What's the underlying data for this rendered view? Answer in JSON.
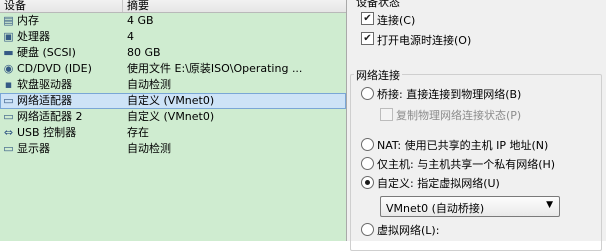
{
  "columns": {
    "device": "设备",
    "summary": "摘要"
  },
  "devices": [
    {
      "name": "内存",
      "summary": "4 GB",
      "icon": "memory-icon",
      "glyph": "▤"
    },
    {
      "name": "处理器",
      "summary": "4",
      "icon": "processor-icon",
      "glyph": "▣"
    },
    {
      "name": "硬盘 (SCSI)",
      "summary": "80 GB",
      "icon": "hard-disk-icon",
      "glyph": "▬"
    },
    {
      "name": "CD/DVD (IDE)",
      "summary": "使用文件 E:\\原装ISO\\Operating ...",
      "icon": "cd-dvd-icon",
      "glyph": "◉"
    },
    {
      "name": "软盘驱动器",
      "summary": "自动检测",
      "icon": "floppy-icon",
      "glyph": "▪"
    },
    {
      "name": "网络适配器",
      "summary": "自定义 (VMnet0)",
      "icon": "network-adapter-icon",
      "glyph": "▭"
    },
    {
      "name": "网络适配器 2",
      "summary": "自定义 (VMnet0)",
      "icon": "network-adapter-icon",
      "glyph": "▭"
    },
    {
      "name": "USB 控制器",
      "summary": "存在",
      "icon": "usb-icon",
      "glyph": "⇔"
    },
    {
      "name": "显示器",
      "summary": "自动检测",
      "icon": "display-icon",
      "glyph": "▭"
    }
  ],
  "selected_index": 5,
  "device_status": {
    "title": "设备状态",
    "connected": {
      "label": "连接(C)",
      "checked": true
    },
    "connect_at_power_on": {
      "label": "打开电源时连接(O)",
      "checked": true
    }
  },
  "network_connection": {
    "title": "网络连接",
    "bridged": {
      "label": "桥接: 直接连接到物理网络(B)",
      "selected": false
    },
    "replicate": {
      "label": "复制物理网络连接状态(P)",
      "checked": false,
      "disabled": true
    },
    "nat": {
      "label": "NAT: 使用已共享的主机 IP 地址(N)",
      "selected": false
    },
    "host_only": {
      "label": "仅主机: 与主机共享一个私有网络(H)",
      "selected": false
    },
    "custom": {
      "label": "自定义: 指定虚拟网络(U)",
      "selected": true
    },
    "custom_select_value": "VMnet0 (自动桥接)",
    "lan_segment": {
      "label": "虚拟网络(L):",
      "selected": false
    }
  }
}
